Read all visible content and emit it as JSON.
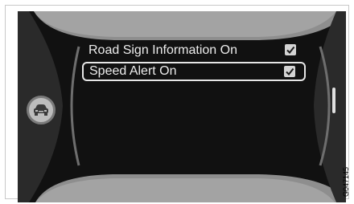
{
  "menu": {
    "items": [
      {
        "label": "Road Sign Information On",
        "checked": true,
        "selected": false
      },
      {
        "label": "Speed Alert On",
        "checked": true,
        "selected": true
      }
    ]
  },
  "side_button": {
    "icon": "car-front-icon"
  },
  "figure_code": "G047145",
  "icons": {
    "checkbox": "checkmark-icon",
    "side": "car-front-icon"
  },
  "colors": {
    "screen_bg": "#111111",
    "panel_grey": "#9a9a9a",
    "text": "#ececec",
    "highlight_border": "#e6e6e6"
  }
}
